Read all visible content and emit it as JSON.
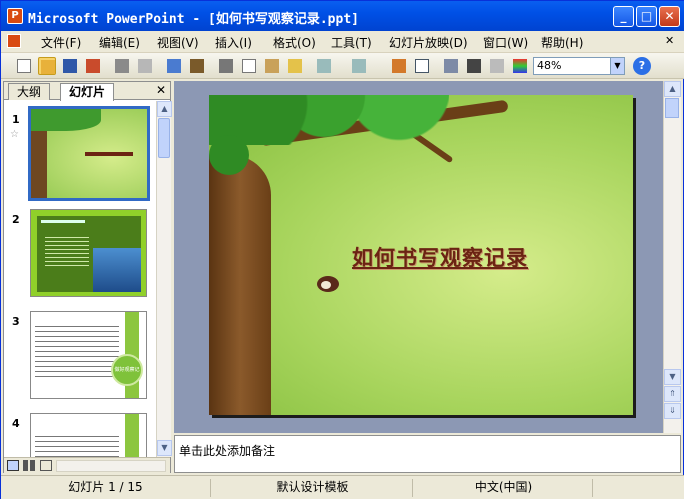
{
  "window": {
    "title": "Microsoft PowerPoint - [如何书写观察记录.ppt]",
    "app_icon": "P",
    "controls": {
      "minimize": "_",
      "maximize": "□",
      "close": "✕"
    }
  },
  "menubar": {
    "items": [
      "文件(F)",
      "编辑(E)",
      "视图(V)",
      "插入(I)",
      "格式(O)",
      "工具(T)",
      "幻灯片放映(D)",
      "窗口(W)",
      "帮助(H)"
    ],
    "close_glyph": "✕"
  },
  "toolbar": {
    "zoom_value": "48%",
    "help_glyph": "?"
  },
  "left_pane": {
    "tabs": [
      "大纲",
      "幻灯片"
    ],
    "active_tab": "幻灯片",
    "close_glyph": "✕",
    "slide_numbers": [
      "1",
      "2",
      "3",
      "4"
    ],
    "thumb3_circle_text": "做好观察记录"
  },
  "slide": {
    "title": "如何书写观察记录"
  },
  "notes": {
    "placeholder": "单击此处添加备注"
  },
  "statusbar": {
    "slide_position": "幻灯片 1 / 15",
    "design_template": "默认设计模板",
    "language": "中文(中国)"
  },
  "colors": {
    "titlebar": "#0050e6",
    "selection": "#316ac5",
    "slide_bg": "#a7d45c",
    "title_text": "#6b2413"
  }
}
